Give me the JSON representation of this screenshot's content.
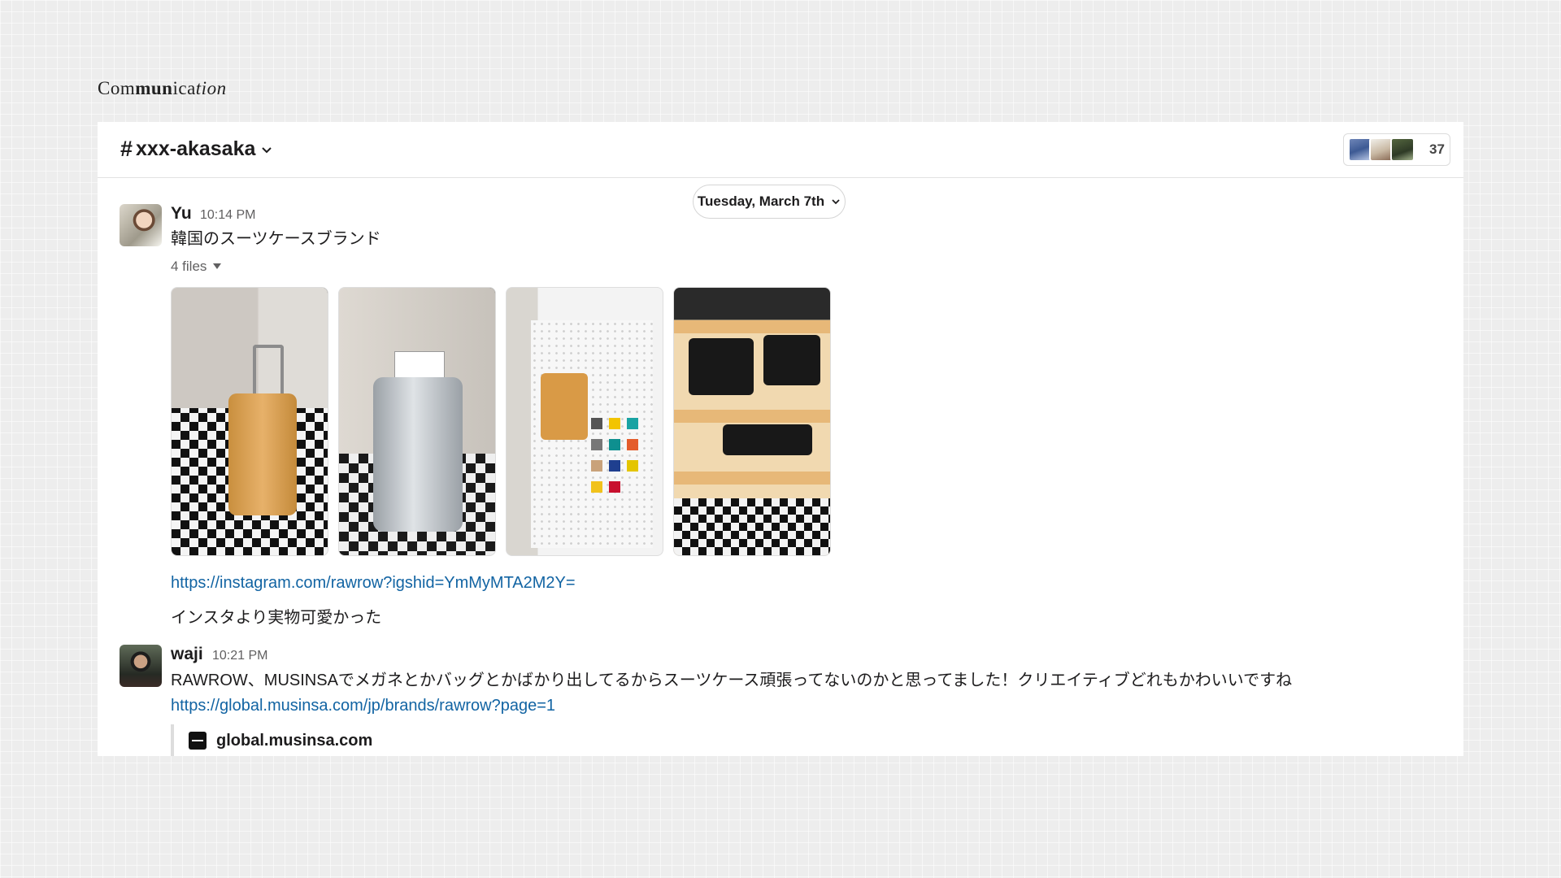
{
  "brand": {
    "part1": "Com",
    "part2": "mun",
    "part3": "ica",
    "part4": "tion"
  },
  "channel": {
    "hash": "#",
    "name": "xxx-akasaka"
  },
  "members": {
    "count": "37"
  },
  "date_divider": {
    "label": "Tuesday, March 7th"
  },
  "messages": [
    {
      "author": "Yu",
      "time": "10:14 PM",
      "text": "韓国のスーツケースブランド",
      "files_label": "4 files",
      "link": "https://instagram.com/rawrow?igshid=YmMyMTA2M2Y=",
      "followup": "インスタより実物可愛かった"
    },
    {
      "author": "waji",
      "time": "10:21 PM",
      "text": "RAWROW、MUSINSAでメガネとかバッグとかばかり出してるからスーツケース頑張ってないのかと思ってました！クリエイティブどれもかわいいですね",
      "link": "https://global.musinsa.com/jp/brands/rawrow?page=1",
      "preview_title": "global.musinsa.com"
    }
  ]
}
